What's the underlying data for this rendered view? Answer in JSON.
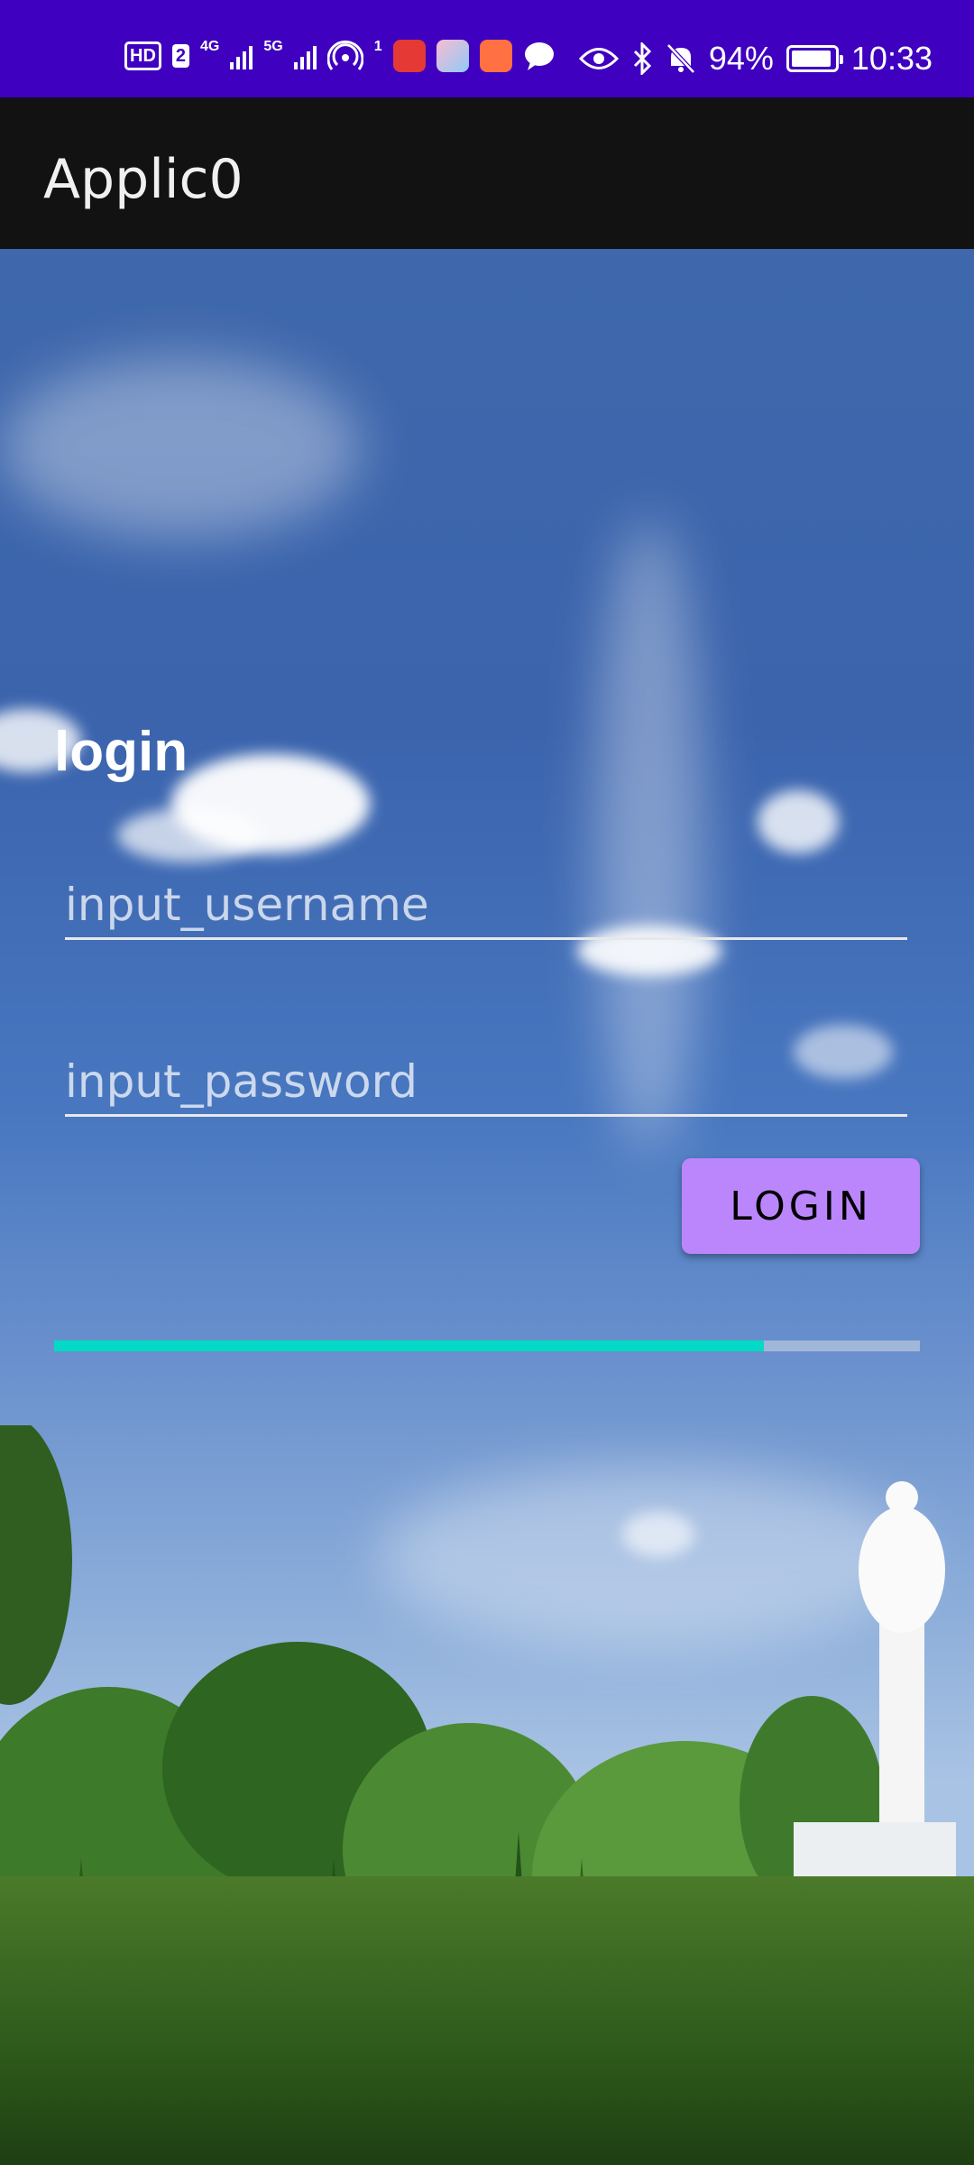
{
  "status_bar": {
    "hd_label": "HD",
    "sim_label": "2",
    "net1": "4G",
    "net2": "5G",
    "hotspot_count": "1",
    "battery_text": "94%",
    "battery_level": 0.94,
    "time": "10:33",
    "background_color": "#3f00c0"
  },
  "app_bar": {
    "title": "Applic0"
  },
  "login": {
    "title": "login",
    "username_placeholder": "input_username",
    "password_placeholder": "input_password",
    "button_label": "LOGIN",
    "button_color": "#bb86fc",
    "progress": 0.82,
    "progress_color": "#03dac5"
  }
}
